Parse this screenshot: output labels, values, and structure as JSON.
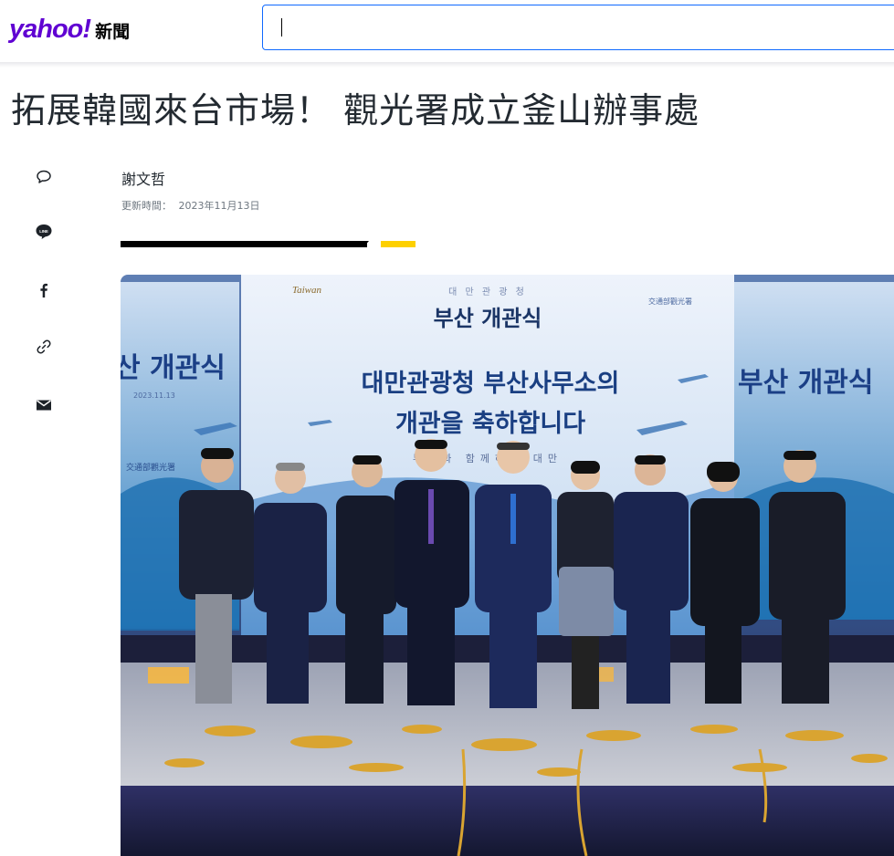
{
  "header": {
    "logo": "yahoo!",
    "section": "新聞",
    "search_value": ""
  },
  "article": {
    "title": "拓展韓國來台市場！ 觀光署成立釜山辦事處",
    "author": "謝文哲",
    "updated_label": "更新時間：",
    "updated_date": "2023年11月13日"
  },
  "share": {
    "icons": [
      "comment-icon",
      "line-icon",
      "facebook-icon",
      "link-icon",
      "mail-icon"
    ]
  },
  "photo": {
    "banner_center_small": "대 만 관 광 청",
    "banner_center_title": "부산 개관식",
    "banner_main_line1": "대만관광청 부산사무소의",
    "banner_main_line2": "개관을 축하합니다",
    "banner_slogan": "부산과 함께하는 대만",
    "banner_left_title": "산 개관식",
    "banner_right_title": "부산 개관식",
    "banner_date": "2023.11.13",
    "banner_logo_text": "Taiwan",
    "banner_left_logo": "交通部觀光署",
    "banner_right_logo": "交通部觀光署"
  },
  "colors": {
    "brand": "#6001d2",
    "search_border": "#0f69ff",
    "divider_accent": "#fdd000"
  }
}
